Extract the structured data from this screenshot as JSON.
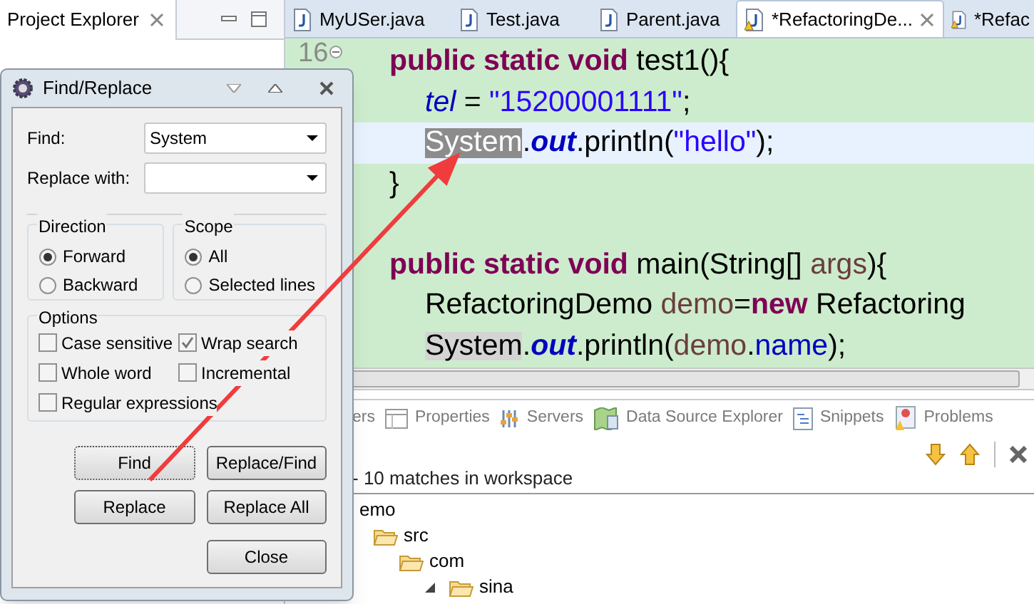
{
  "project_explorer": {
    "title": "Project Explorer"
  },
  "editor": {
    "tabs": [
      {
        "label": "MyUSer.java",
        "selected": false,
        "warning": false
      },
      {
        "label": "Test.java",
        "selected": false,
        "warning": false
      },
      {
        "label": "Parent.java",
        "selected": false,
        "warning": false
      },
      {
        "label": "*RefactoringDe...",
        "selected": true,
        "warning": true
      },
      {
        "label": "*Refac",
        "selected": false,
        "warning": true
      }
    ],
    "line_number": "16",
    "lines": [
      {
        "current": false,
        "tokens": [
          {
            "kind": "keyword",
            "text": "public static void"
          },
          {
            "kind": "plain",
            "text": " test1(){"
          }
        ],
        "children": [
          {
            "current": false,
            "tokens": [
              {
                "kind": "static",
                "text": "tel"
              },
              {
                "kind": "plain",
                "text": " = "
              },
              {
                "kind": "string",
                "text": "\"15200001111\""
              },
              {
                "kind": "plain",
                "text": ";"
              }
            ]
          },
          {
            "current": true,
            "tokens": [
              {
                "kind": "plain",
                "text": "System",
                "selected": true
              },
              {
                "kind": "plain",
                "text": "."
              },
              {
                "kind": "constant",
                "text": "out"
              },
              {
                "kind": "plain",
                "text": ".println("
              },
              {
                "kind": "string",
                "text": "\"hello\""
              },
              {
                "kind": "plain",
                "text": ");"
              }
            ]
          }
        ]
      },
      {
        "current": false,
        "tokens": [
          {
            "kind": "plain",
            "text": "}"
          }
        ]
      },
      {
        "current": false,
        "tokens": [
          {
            "kind": "keyword",
            "text": "public static void"
          },
          {
            "kind": "plain",
            "text": " main(String[] "
          },
          {
            "kind": "local",
            "text": "args"
          },
          {
            "kind": "plain",
            "text": "){"
          }
        ],
        "children": [
          {
            "current": false,
            "tokens": [
              {
                "kind": "plain",
                "text": "RefactoringDemo "
              },
              {
                "kind": "local",
                "text": "demo"
              },
              {
                "kind": "plain",
                "text": "="
              },
              {
                "kind": "keyword",
                "text": "new"
              },
              {
                "kind": "plain",
                "text": " Refactoring"
              }
            ]
          },
          {
            "current": false,
            "tokens": [
              {
                "kind": "plain",
                "text": "System",
                "occurrence": true
              },
              {
                "kind": "plain",
                "text": "."
              },
              {
                "kind": "constant",
                "text": "out"
              },
              {
                "kind": "plain",
                "text": ".println("
              },
              {
                "kind": "local",
                "text": "demo"
              },
              {
                "kind": "plain",
                "text": "."
              },
              {
                "kind": "field",
                "text": "name"
              },
              {
                "kind": "plain",
                "text": ");"
              }
            ]
          }
        ]
      }
    ]
  },
  "bottom_panel": {
    "tabs": [
      {
        "label": "ers"
      },
      {
        "label": "Properties"
      },
      {
        "label": "Servers"
      },
      {
        "label": "Data Source Explorer"
      },
      {
        "label": "Snippets"
      },
      {
        "label": "Problems"
      }
    ],
    "status": "- 10 matches in workspace",
    "tree": [
      {
        "label": "emo",
        "children": [
          {
            "label": "src",
            "children": [
              {
                "label": "com",
                "children": [
                  {
                    "label": "sina",
                    "expanded": true
                  }
                ]
              }
            ]
          }
        ]
      }
    ]
  },
  "dialog": {
    "title": "Find/Replace",
    "find_label": "Find:",
    "find_value": "System",
    "replace_label": "Replace with:",
    "direction": {
      "title": "Direction",
      "options": [
        {
          "label": "Forward",
          "selected": true
        },
        {
          "label": "Backward",
          "selected": false
        }
      ]
    },
    "scope": {
      "title": "Scope",
      "options": [
        {
          "label": "All",
          "selected": true
        },
        {
          "label": "Selected lines",
          "selected": false
        }
      ]
    },
    "options": {
      "title": "Options",
      "checkboxes": [
        {
          "label": "Case sensitive",
          "checked": false
        },
        {
          "label": "Wrap search",
          "checked": true
        },
        {
          "label": "Whole word",
          "checked": false
        },
        {
          "label": "Incremental",
          "checked": false
        },
        {
          "label": "Regular expressions",
          "checked": false
        }
      ]
    },
    "buttons": [
      {
        "label": "Find",
        "focused": true
      },
      {
        "label": "Replace/Find",
        "focused": false
      },
      {
        "label": "Replace",
        "focused": false
      },
      {
        "label": "Replace All",
        "focused": false
      },
      {
        "label": "Close",
        "focused": false
      }
    ]
  }
}
